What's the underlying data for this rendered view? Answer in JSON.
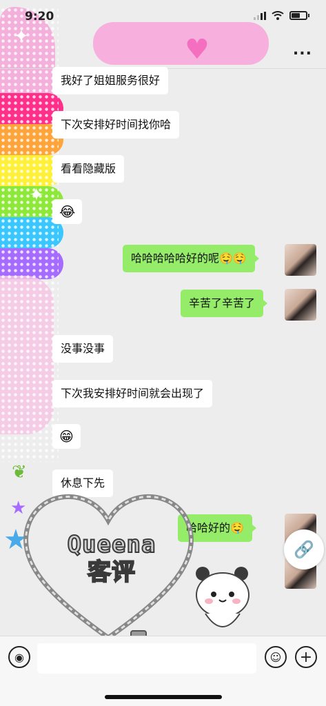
{
  "status_bar": {
    "time": "9:20",
    "location_icon": "location-arrow-icon",
    "signal_icon": "cellular-signal-icon",
    "wifi_icon": "wifi-icon",
    "battery_icon": "battery-icon"
  },
  "nav": {
    "more_label": "..."
  },
  "messages": [
    {
      "side": "in",
      "text": "我好了姐姐服务很好"
    },
    {
      "side": "in",
      "text": "下次安排好时间找你哈"
    },
    {
      "side": "in",
      "text": "看看隐藏版"
    },
    {
      "side": "in",
      "text": "😂"
    },
    {
      "side": "out",
      "text": "哈哈哈哈哈好的呢🤤🤤"
    },
    {
      "side": "out",
      "text": "辛苦了辛苦了"
    },
    {
      "side": "in",
      "text": "没事没事"
    },
    {
      "side": "in",
      "text": "下次我安排好时间就会出现了"
    },
    {
      "side": "in",
      "text": "😁"
    },
    {
      "side": "in",
      "text": "休息下先"
    },
    {
      "side": "out",
      "text": "哈哈好的🤤"
    }
  ],
  "watermark": {
    "line1": "Queena",
    "line2": "客评"
  },
  "link_icon": "link-icon",
  "input_bar": {
    "voice_icon": "voice-icon",
    "emoji_icon": "smiley-icon",
    "plus_icon": "plus-icon",
    "voice_glyph": "◉",
    "emoji_glyph": "☺",
    "plus_glyph": "+"
  },
  "colors": {
    "bubble_out": "#95ec69",
    "bubble_in": "#ffffff",
    "background": "#ededed",
    "deco_pink": "#f3a8d8"
  }
}
